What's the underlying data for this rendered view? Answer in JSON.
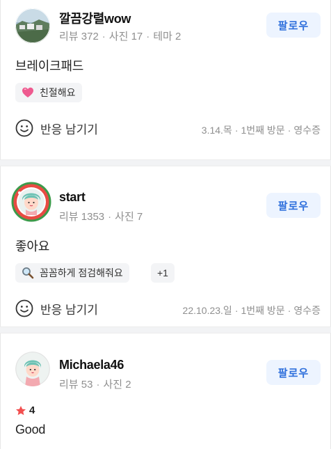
{
  "reviews": [
    {
      "name": "깔끔강렬wow",
      "stats": [
        "리뷰 372",
        "사진 17",
        "테마 2"
      ],
      "follow_label": "팔로우",
      "text": "브레이크패드",
      "tag": "친절해요",
      "tag_icon": "heart-emoji-icon",
      "react_label": "반응 남기기",
      "visit": [
        "3.14.목",
        "1번째 방문",
        "영수증"
      ]
    },
    {
      "name": "start",
      "stats": [
        "리뷰 1353",
        "사진 7"
      ],
      "follow_label": "팔로우",
      "text": "좋아요",
      "tag": "꼼꼼하게 점검해줘요",
      "tag_icon": "magnifier-icon",
      "tag_more": "+1",
      "react_label": "반응 남기기",
      "visit": [
        "22.10.23.일",
        "1번째 방문",
        "영수증"
      ]
    },
    {
      "name": "Michaela46",
      "stats": [
        "리뷰 53",
        "사진 2"
      ],
      "follow_label": "팔로우",
      "rating": "4",
      "text": "Good"
    }
  ],
  "colors": {
    "accent": "#2e6fdc",
    "follow_bg": "#edf4ff",
    "star": "#f24f4f",
    "meta": "#8f8f8f"
  }
}
